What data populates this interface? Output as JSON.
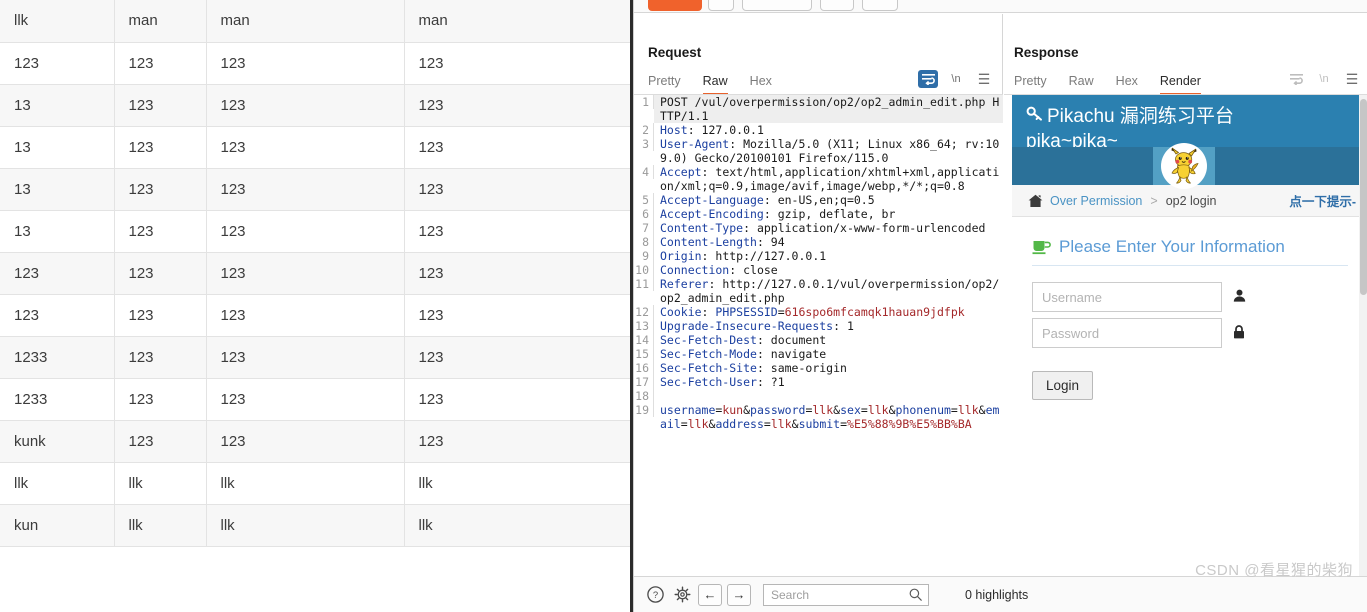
{
  "table": {
    "rows": [
      [
        "llk",
        "man",
        "man",
        "man"
      ],
      [
        "123",
        "123",
        "123",
        "123"
      ],
      [
        "13",
        "123",
        "123",
        "123"
      ],
      [
        "13",
        "123",
        "123",
        "123"
      ],
      [
        "13",
        "123",
        "123",
        "123"
      ],
      [
        "13",
        "123",
        "123",
        "123"
      ],
      [
        "123",
        "123",
        "123",
        "123"
      ],
      [
        "123",
        "123",
        "123",
        "123"
      ],
      [
        "1233",
        "123",
        "123",
        "123"
      ],
      [
        "1233",
        "123",
        "123",
        "123"
      ],
      [
        "kunk",
        "123",
        "123",
        "123"
      ],
      [
        "llk",
        "llk",
        "llk",
        "llk"
      ],
      [
        "kun",
        "llk",
        "llk",
        "llk"
      ]
    ]
  },
  "toolbar": {
    "send_label": "",
    "cancel_label": "",
    "forward_label": "",
    "layout_buttons": [
      {
        "name": "split-vertical",
        "active": true
      },
      {
        "name": "split-horizontal",
        "active": false
      },
      {
        "name": "single-pane",
        "active": false
      }
    ]
  },
  "request": {
    "title": "Request",
    "tabs": [
      {
        "label": "Pretty",
        "active": false
      },
      {
        "label": "Raw",
        "active": true
      },
      {
        "label": "Hex",
        "active": false
      }
    ],
    "tools": {
      "wrap_label": "↵",
      "newline_label": "\\n",
      "menu_label": "☰"
    },
    "lines": [
      {
        "n": "1",
        "highlight": true,
        "parts": [
          {
            "t": "POST /vul/overpermission/op2/op2_admin_edit.php HTTP/1.1",
            "c": "val"
          }
        ]
      },
      {
        "n": "2",
        "parts": [
          {
            "t": "Host",
            "c": "hdr"
          },
          {
            "t": ": 127.0.0.1",
            "c": "val"
          }
        ]
      },
      {
        "n": "3",
        "parts": [
          {
            "t": "User-Agent",
            "c": "hdr"
          },
          {
            "t": ": Mozilla/5.0 (X11; Linux x86_64; rv:109.0) Gecko/20100101 Firefox/115.0",
            "c": "val"
          }
        ]
      },
      {
        "n": "4",
        "parts": [
          {
            "t": "Accept",
            "c": "hdr"
          },
          {
            "t": ": text/html,application/xhtml+xml,application/xml;q=0.9,image/avif,image/webp,*/*;q=0.8",
            "c": "val"
          }
        ]
      },
      {
        "n": "5",
        "parts": [
          {
            "t": "Accept-Language",
            "c": "hdr"
          },
          {
            "t": ": en-US,en;q=0.5",
            "c": "val"
          }
        ]
      },
      {
        "n": "6",
        "parts": [
          {
            "t": "Accept-Encoding",
            "c": "hdr"
          },
          {
            "t": ": gzip, deflate, br",
            "c": "val"
          }
        ]
      },
      {
        "n": "7",
        "parts": [
          {
            "t": "Content-Type",
            "c": "hdr"
          },
          {
            "t": ": application/x-www-form-urlencoded",
            "c": "val"
          }
        ]
      },
      {
        "n": "8",
        "parts": [
          {
            "t": "Content-Length",
            "c": "hdr"
          },
          {
            "t": ": 94",
            "c": "val"
          }
        ]
      },
      {
        "n": "9",
        "parts": [
          {
            "t": "Origin",
            "c": "hdr"
          },
          {
            "t": ": http://127.0.0.1",
            "c": "val"
          }
        ]
      },
      {
        "n": "10",
        "parts": [
          {
            "t": "Connection",
            "c": "hdr"
          },
          {
            "t": ": close",
            "c": "val"
          }
        ]
      },
      {
        "n": "11",
        "parts": [
          {
            "t": "Referer",
            "c": "hdr"
          },
          {
            "t": ": http://127.0.0.1/vul/overpermission/op2/op2_admin_edit.php",
            "c": "val"
          }
        ]
      },
      {
        "n": "12",
        "parts": [
          {
            "t": "Cookie",
            "c": "hdr"
          },
          {
            "t": ": ",
            "c": "val"
          },
          {
            "t": "PHPSESSID",
            "c": "blu"
          },
          {
            "t": "=",
            "c": "val"
          },
          {
            "t": "616spo6mfcamqk1hauan9jdfpk",
            "c": "red"
          }
        ]
      },
      {
        "n": "13",
        "parts": [
          {
            "t": "Upgrade-Insecure-Requests",
            "c": "hdr"
          },
          {
            "t": ": 1",
            "c": "val"
          }
        ]
      },
      {
        "n": "14",
        "parts": [
          {
            "t": "Sec-Fetch-Dest",
            "c": "hdr"
          },
          {
            "t": ": document",
            "c": "val"
          }
        ]
      },
      {
        "n": "15",
        "parts": [
          {
            "t": "Sec-Fetch-Mode",
            "c": "hdr"
          },
          {
            "t": ": navigate",
            "c": "val"
          }
        ]
      },
      {
        "n": "16",
        "parts": [
          {
            "t": "Sec-Fetch-Site",
            "c": "hdr"
          },
          {
            "t": ": same-origin",
            "c": "val"
          }
        ]
      },
      {
        "n": "17",
        "parts": [
          {
            "t": "Sec-Fetch-User",
            "c": "hdr"
          },
          {
            "t": ": ?1",
            "c": "val"
          }
        ]
      },
      {
        "n": "18",
        "parts": [
          {
            "t": "",
            "c": "val"
          }
        ]
      },
      {
        "n": "19",
        "parts": [
          {
            "t": "username",
            "c": "blu"
          },
          {
            "t": "=",
            "c": "val"
          },
          {
            "t": "kun",
            "c": "red"
          },
          {
            "t": "&",
            "c": "val"
          },
          {
            "t": "password",
            "c": "blu"
          },
          {
            "t": "=",
            "c": "val"
          },
          {
            "t": "llk",
            "c": "red"
          },
          {
            "t": "&",
            "c": "val"
          },
          {
            "t": "sex",
            "c": "blu"
          },
          {
            "t": "=",
            "c": "val"
          },
          {
            "t": "llk",
            "c": "red"
          },
          {
            "t": "&",
            "c": "val"
          },
          {
            "t": "phonenum",
            "c": "blu"
          },
          {
            "t": "=",
            "c": "val"
          },
          {
            "t": "llk",
            "c": "red"
          },
          {
            "t": "&",
            "c": "val"
          },
          {
            "t": "email",
            "c": "blu"
          },
          {
            "t": "=",
            "c": "val"
          },
          {
            "t": "llk",
            "c": "red"
          },
          {
            "t": "&",
            "c": "val"
          },
          {
            "t": "address",
            "c": "blu"
          },
          {
            "t": "=",
            "c": "val"
          },
          {
            "t": "llk",
            "c": "red"
          },
          {
            "t": "&",
            "c": "val"
          },
          {
            "t": "submit",
            "c": "blu"
          },
          {
            "t": "=",
            "c": "val"
          },
          {
            "t": "%E5%88%9B%E5%BB%BA",
            "c": "red"
          }
        ]
      }
    ]
  },
  "response": {
    "title": "Response",
    "tabs": [
      {
        "label": "Pretty",
        "active": false
      },
      {
        "label": "Raw",
        "active": false
      },
      {
        "label": "Hex",
        "active": false
      },
      {
        "label": "Render",
        "active": true
      }
    ],
    "tools": {
      "wrap_label": "↵",
      "newline_label": "\\n",
      "menu_label": "☰"
    },
    "render": {
      "banner_title": "Pikachu 漏洞练习平台",
      "banner_subtitle": "pika~pika~",
      "breadcrumb": {
        "home_icon": "home-icon",
        "root": "Over Permission",
        "separator": ">",
        "current": "op2 login",
        "tip": "点一下提示-"
      },
      "form": {
        "heading": "Please Enter Your Information",
        "username_placeholder": "Username",
        "username_value": "",
        "password_placeholder": "Password",
        "password_value": "",
        "login_label": "Login"
      }
    }
  },
  "bottom": {
    "help_label": "?",
    "settings_label": "⚙",
    "back_label": "←",
    "forward_label": "→",
    "search_placeholder": "Search",
    "search_value": "",
    "highlights": "0 highlights"
  },
  "watermark": "CSDN @看星猩的柴狗",
  "colors": {
    "accent_orange": "#e8622c",
    "accent_blue": "#2f6ea8",
    "banner_blue": "#2b80b0",
    "header_text": "#1b3fa0",
    "value_red": "#a4282a"
  }
}
